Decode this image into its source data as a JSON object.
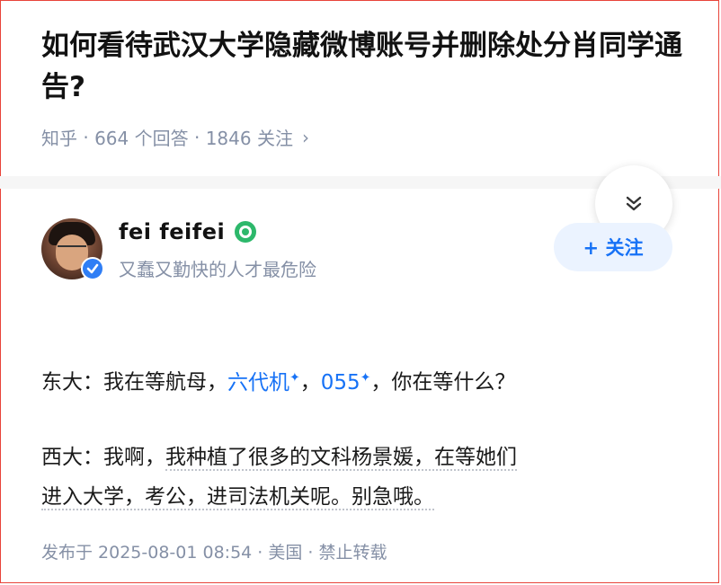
{
  "question": {
    "title": "如何看待武汉大学隐藏微博账号并删除处分肖同学通告?",
    "source": "知乎",
    "answers_count": "664 个回答",
    "followers_count": "1846 关注",
    "chevron": "›"
  },
  "author": {
    "name": "fei  feifei",
    "bio": "又蠢又勤快的人才最危险",
    "follow_label": "+ 关注",
    "badge_icon": "green-medal-icon",
    "verified_icon": "blue-verified-icon"
  },
  "answer": {
    "p1_prefix": "东大：我在等航母，",
    "p1_link1": "六代机",
    "p1_sep": "，",
    "p1_link2": "055",
    "p1_suffix": "，你在等什么？",
    "p2_prefix": "西大：我啊，",
    "p2_underlined_1": "我种植了很多的文科杨景媛，在等她们",
    "p2_underlined_2": "进入大学，考公，进司法机关呢。别急哦。",
    "spark": "✦"
  },
  "footer": {
    "published": "发布于  2025-08-01 08:54 · 美国 · 禁止转载"
  },
  "colors": {
    "accent": "#1772f6",
    "meta": "#8590a6",
    "frame": "#e8443a"
  }
}
